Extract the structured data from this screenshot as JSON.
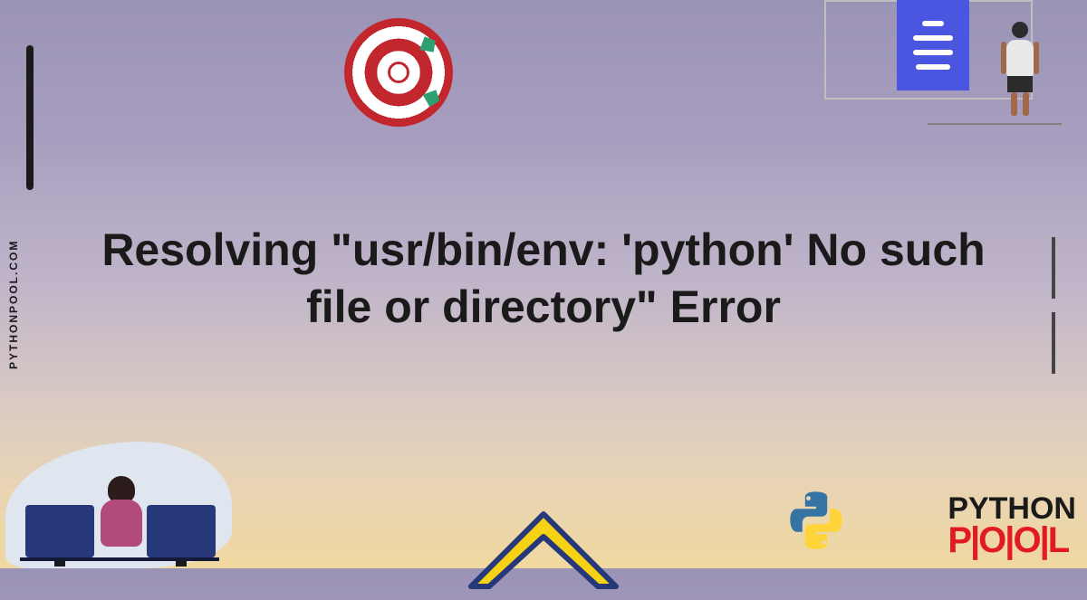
{
  "title": "Resolving \"usr/bin/env: 'python' No such file or directory\" Error",
  "site_url": "PYTHONPOOL.COM",
  "logo": {
    "line1": "PYTHON",
    "line2": "P|O|O|L"
  },
  "icons": {
    "target": "target-icon",
    "menu": "menu-icon",
    "python": "python-logo-icon",
    "chevron": "chevron-up-icon"
  }
}
